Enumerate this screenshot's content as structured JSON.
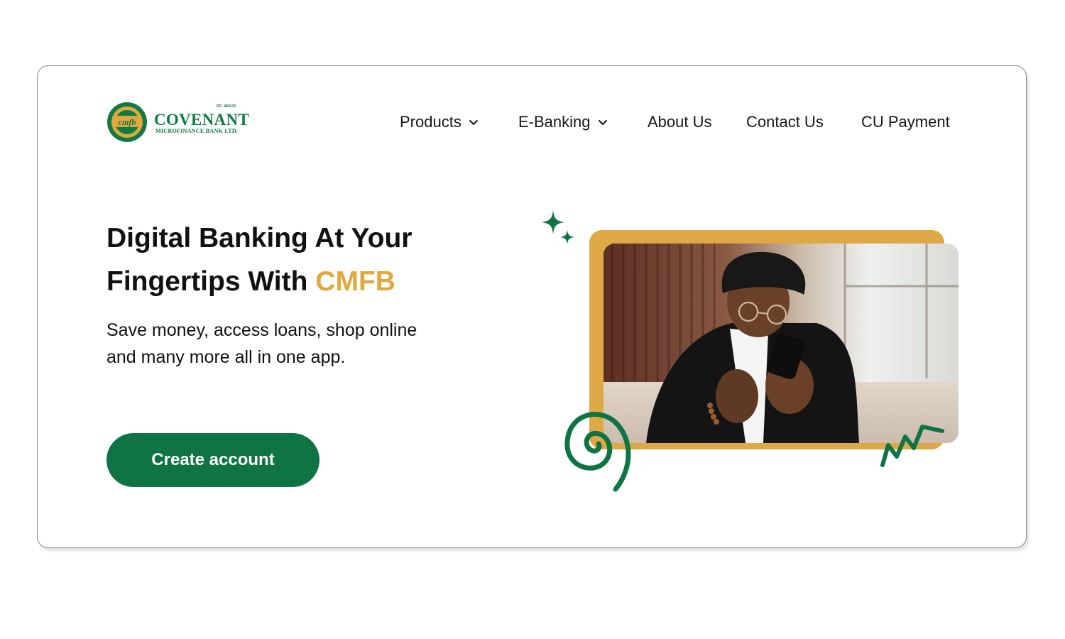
{
  "brand": {
    "name": "COVENANT",
    "subtitle": "MICROFINANCE BANK LTD.",
    "rc_number": "RC: 480133",
    "mark_text": "cmfb",
    "colors": {
      "green": "#0f7444",
      "gold": "#dfa846"
    }
  },
  "nav": {
    "items": [
      {
        "label": "Products",
        "has_dropdown": true
      },
      {
        "label": "E-Banking",
        "has_dropdown": true
      },
      {
        "label": "About Us",
        "has_dropdown": false
      },
      {
        "label": "Contact Us",
        "has_dropdown": false
      },
      {
        "label": "CU Payment",
        "has_dropdown": false
      }
    ]
  },
  "hero": {
    "headline_line1": "Digital Banking At Your",
    "headline_line2": "Fingertips With ",
    "headline_accent": "CMFB",
    "description": "Save money, access loans, shop online and many more all in one app.",
    "cta_label": "Create account"
  },
  "illustration": {
    "photo": "man-using-smartphone-photo",
    "decorations": [
      "sparkle-icon",
      "spiral-icon",
      "zigzag-icon"
    ]
  }
}
